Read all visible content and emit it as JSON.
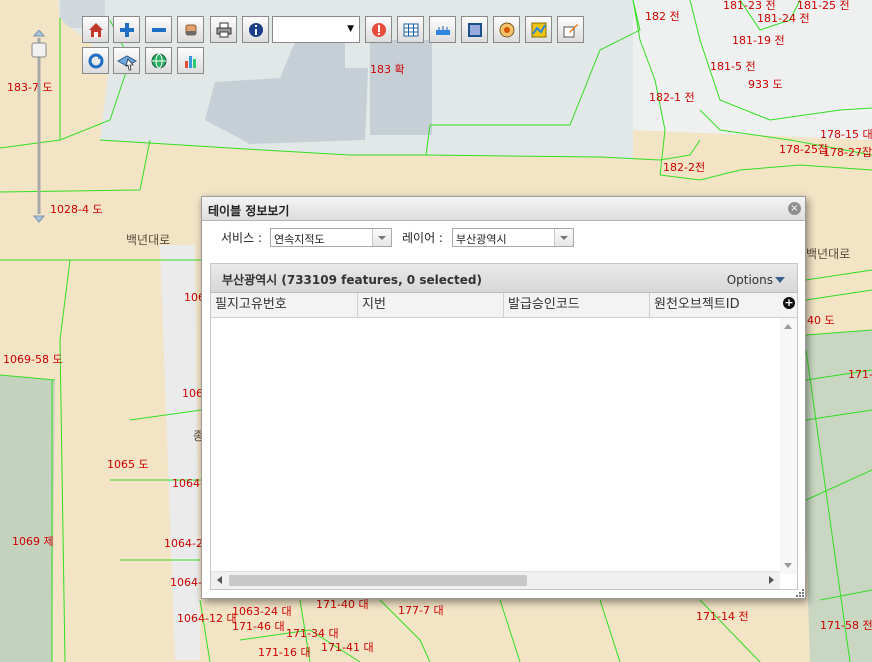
{
  "toolbar": {
    "row1": [
      "home-icon",
      "zoom-in-icon",
      "zoom-out-icon",
      "erase-icon",
      "print-icon",
      "info-icon"
    ],
    "scale_value": "",
    "row1b": [
      "alert-icon",
      "table-icon",
      "ruler-icon",
      "select-area-icon",
      "target-icon",
      "layer-map-icon",
      "edit-icon"
    ],
    "row2": [
      "refresh-icon",
      "map-layers-icon",
      "globe-icon",
      "chart-icon"
    ]
  },
  "map_labels": [
    {
      "text": "182 전"
    },
    {
      "text": "181-23 전"
    },
    {
      "text": "181-25 전"
    },
    {
      "text": "181-24 전"
    },
    {
      "text": "181-19 전"
    },
    {
      "text": "181-5 전"
    },
    {
      "text": "933 도"
    },
    {
      "text": "183 확"
    },
    {
      "text": "182-1 전"
    },
    {
      "text": "178-15 대"
    },
    {
      "text": "178-25잡"
    },
    {
      "text": "178-27잡"
    },
    {
      "text": "182-2전"
    },
    {
      "text": "183-7 도"
    },
    {
      "text": "1028-4 도"
    },
    {
      "text": "1069-58 도"
    },
    {
      "text": "1065 도"
    },
    {
      "text": "1064-"
    },
    {
      "text": "1069 제"
    },
    {
      "text": "1064-2"
    },
    {
      "text": "1064-"
    },
    {
      "text": "106"
    },
    {
      "text": "106"
    },
    {
      "text": "40 도"
    },
    {
      "text": "171-"
    },
    {
      "text": "1063-24 대"
    },
    {
      "text": "1064-12 대"
    },
    {
      "text": "171-46 대"
    },
    {
      "text": "171-34 대"
    },
    {
      "text": "171-16 대"
    },
    {
      "text": "171-41 대"
    },
    {
      "text": "171-40 대"
    },
    {
      "text": "177-7 대"
    },
    {
      "text": "171-14 전"
    },
    {
      "text": "171-58 전"
    }
  ],
  "road_labels": [
    {
      "text": "백년대로"
    },
    {
      "text": "백년대로"
    },
    {
      "text": "종"
    }
  ],
  "dialog": {
    "title": "테이블 정보보기",
    "service_label": "서비스 :",
    "service_value": "연속지적도",
    "layer_label": "레이어 :",
    "layer_value": "부산광역시",
    "grid_title": "부산광역시 (733109 features, 0 selected)",
    "options_label": "Options",
    "columns": [
      "필지고유번호",
      "지번",
      "발급승인코드",
      "원천오브젝트ID"
    ],
    "add_column": "+"
  }
}
